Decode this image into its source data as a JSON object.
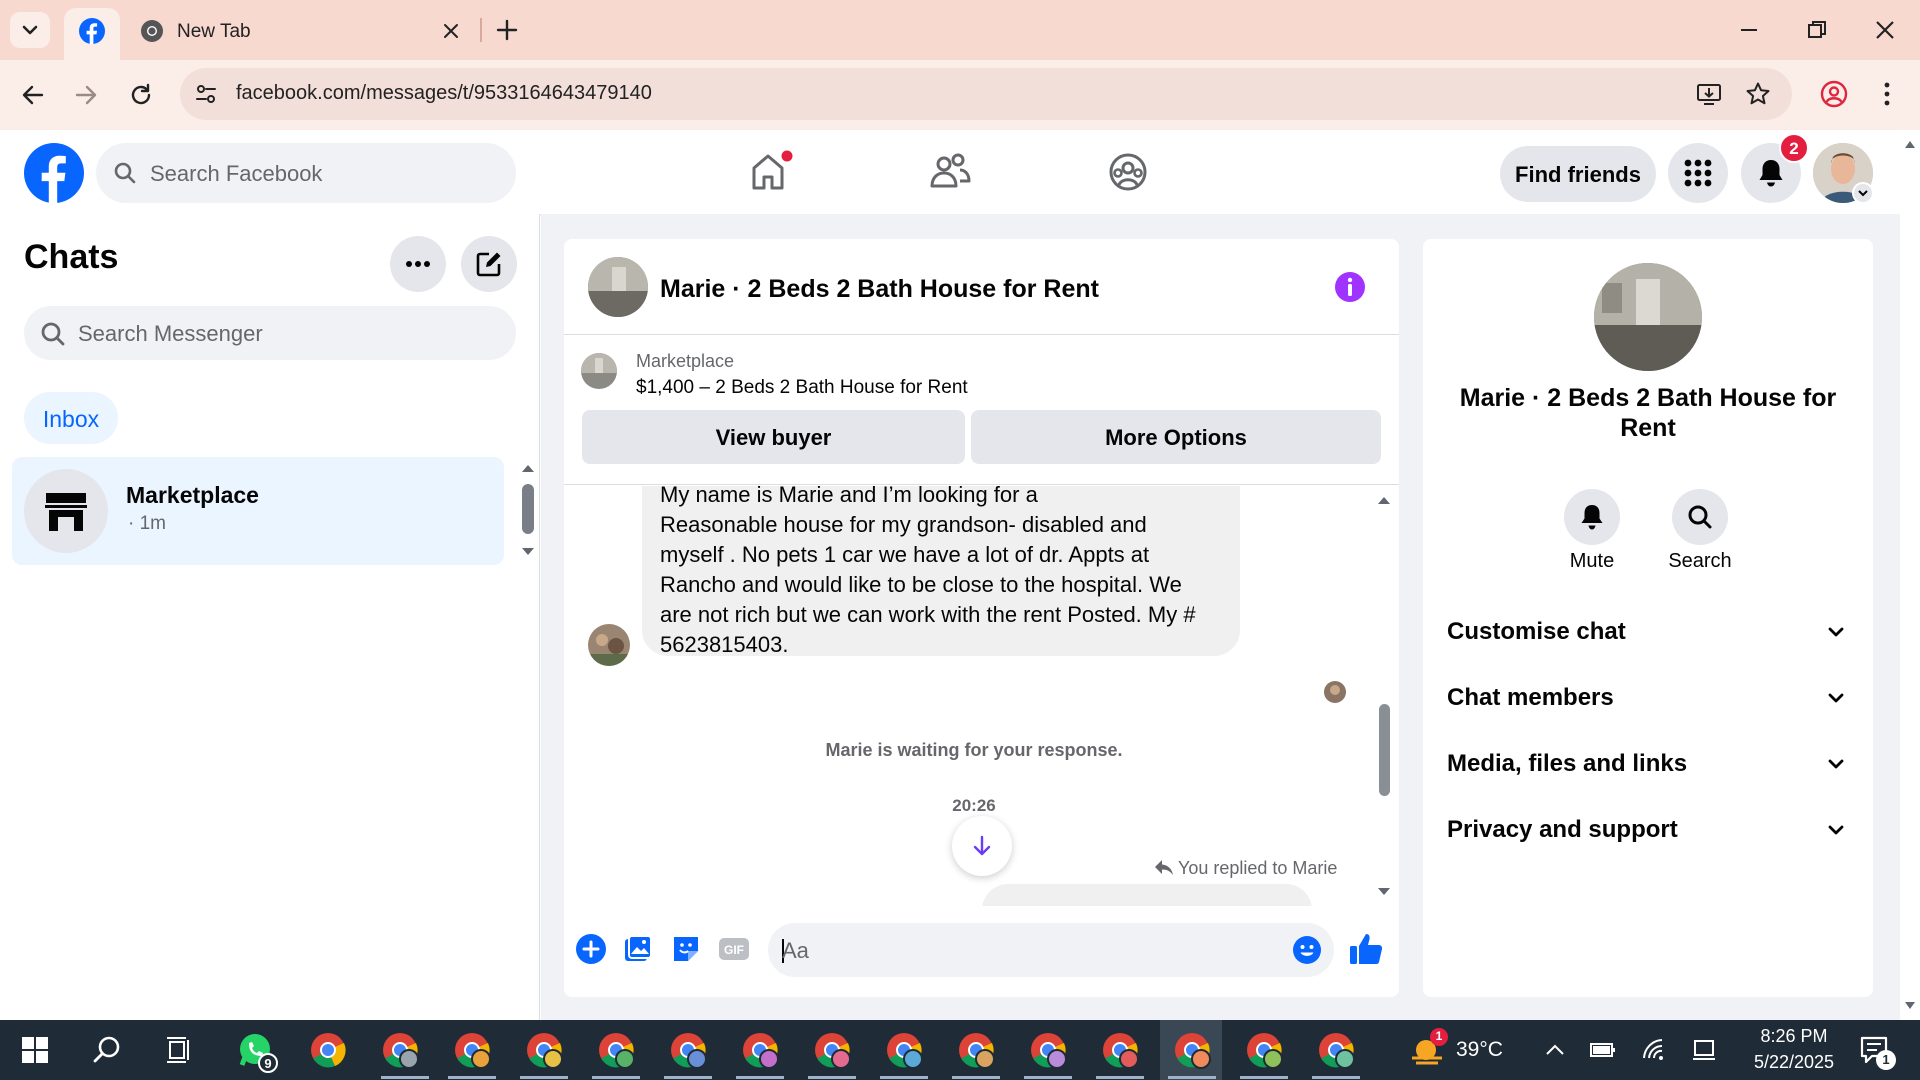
{
  "browser": {
    "tab_title": "New Tab",
    "url": "facebook.com/messages/t/9533164643479140"
  },
  "header": {
    "search_placeholder": "Search Facebook",
    "find_friends": "Find friends",
    "notification_count": "2"
  },
  "chats": {
    "title": "Chats",
    "search_placeholder": "Search Messenger",
    "inbox_label": "Inbox",
    "items": [
      {
        "name": "Marketplace",
        "time": "· 1m"
      }
    ]
  },
  "conversation": {
    "title": "Marie · 2 Beds 2 Bath House for Rent",
    "listing_source": "Marketplace",
    "listing_title": "$1,400 – 2 Beds 2 Bath House for Rent",
    "view_buyer": "View buyer",
    "more_options": "More Options",
    "message_lines": [
      "My name is Marie and I’m looking for a",
      "Reasonable house for my grandson- disabled and",
      "myself . No pets 1 car we have a lot of dr. Appts at",
      "Rancho and would like to be close to the hospital. We",
      "are not rich but we can work with the rent Posted.  My #",
      "5623815403."
    ],
    "waiting_notice": "Marie is waiting for your response.",
    "timestamp": "20:26",
    "replied_label": "You replied to Marie",
    "composer_placeholder": "Aa"
  },
  "details": {
    "title": "Marie · 2 Beds 2 Bath House for Rent",
    "mute": "Mute",
    "search": "Search",
    "sections": [
      "Customise chat",
      "Chat members",
      "Media, files and links",
      "Privacy and support"
    ]
  },
  "taskbar": {
    "whatsapp_badge": "9",
    "weather_badge": "1",
    "temperature": "39°C",
    "time": "8:26 PM",
    "date": "5/22/2025",
    "notification_badge": "1"
  },
  "colors": {
    "facebook_blue": "#0866ff",
    "messenger_purple": "#a033ff",
    "notification_red": "#e41e3f",
    "selected_chat_bg": "#ebf5ff"
  }
}
